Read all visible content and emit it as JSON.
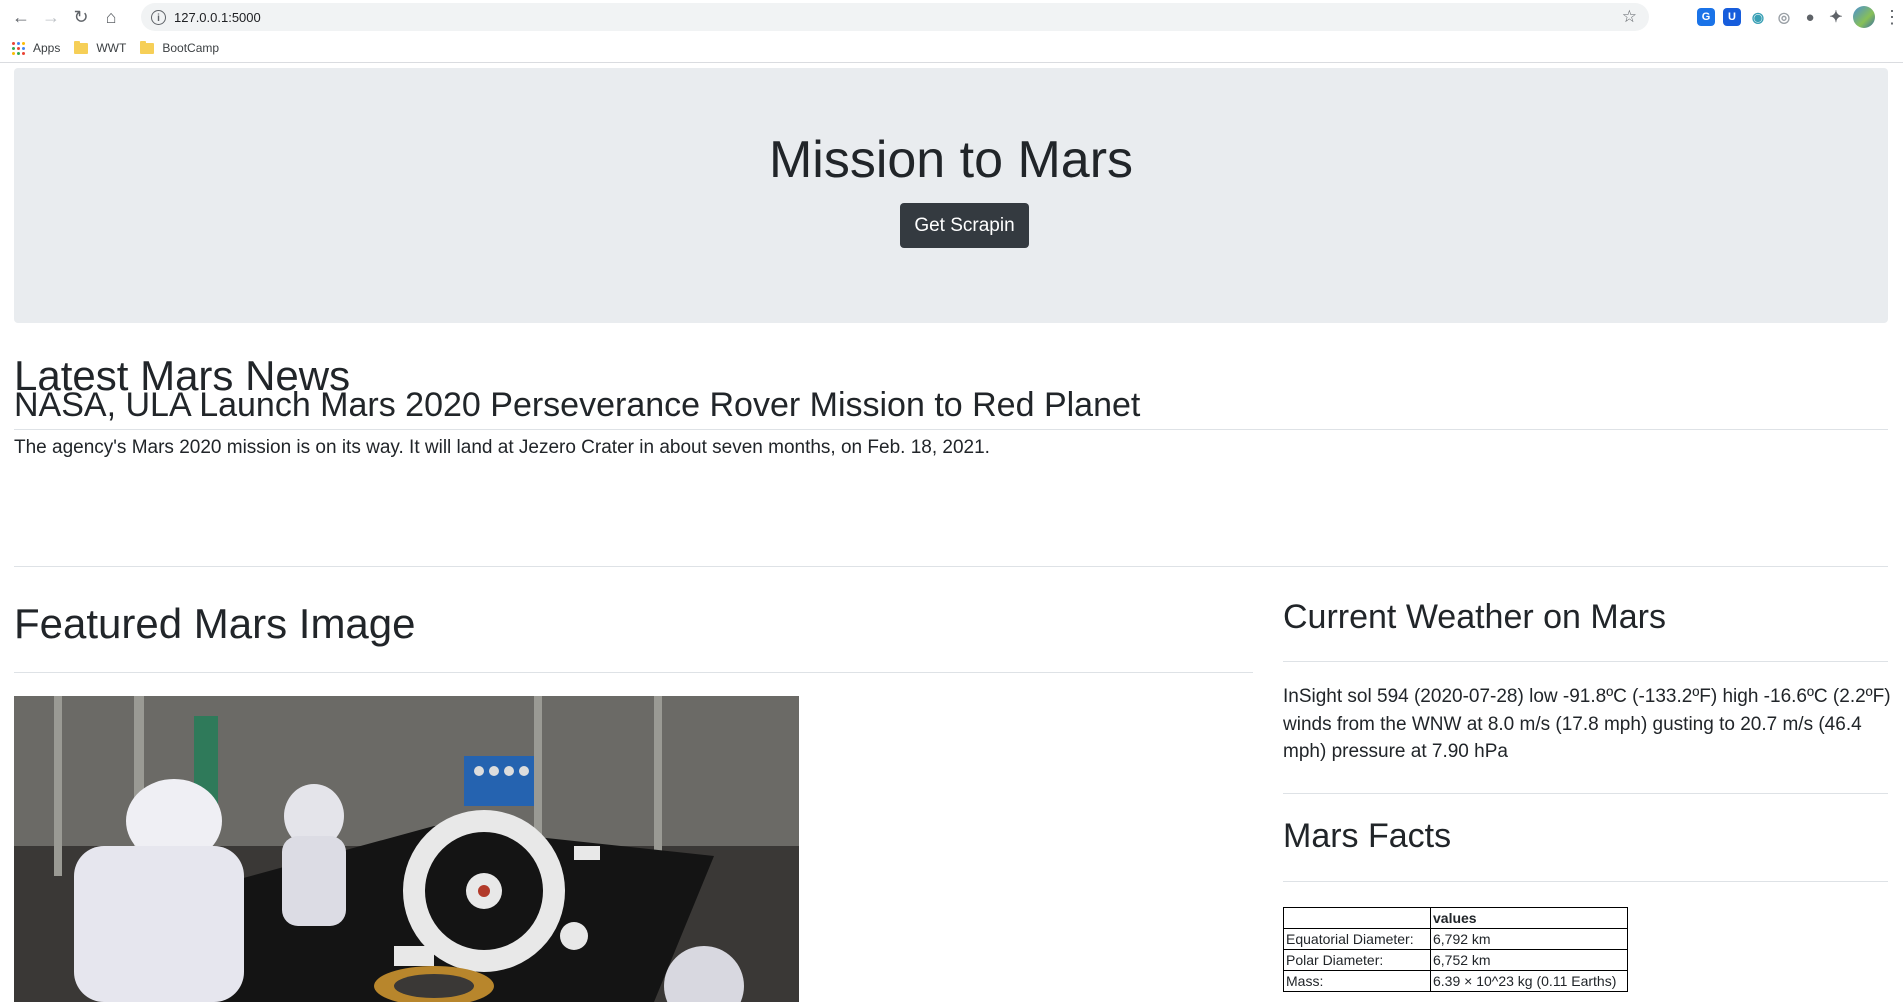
{
  "browser": {
    "url": "127.0.0.1:5000",
    "bookmarks": [
      {
        "label": "Apps"
      },
      {
        "label": "WWT"
      },
      {
        "label": "BootCamp"
      }
    ]
  },
  "jumbotron": {
    "title": "Mission to Mars",
    "button_label": "Get Scrapin"
  },
  "news": {
    "heading": "Latest Mars News",
    "title": "NASA, ULA Launch Mars 2020 Perseverance Rover Mission to Red Planet",
    "teaser": "The agency's Mars 2020 mission is on its way. It will land at Jezero Crater in about seven months, on Feb. 18, 2021."
  },
  "featured": {
    "heading": "Featured Mars Image"
  },
  "weather": {
    "heading": "Current Weather on Mars",
    "text": "InSight sol 594 (2020-07-28) low -91.8ºC (-133.2ºF) high -16.6ºC (2.2ºF) winds from the WNW at 8.0 m/s (17.8 mph) gusting to 20.7 m/s (46.4 mph) pressure at 7.90 hPa"
  },
  "facts": {
    "heading": "Mars Facts",
    "column_header": "values",
    "rows": [
      {
        "label": "Equatorial Diameter:",
        "value": "6,792 km"
      },
      {
        "label": "Polar Diameter:",
        "value": "6,752 km"
      },
      {
        "label": "Mass:",
        "value": "6.39 × 10^23 kg (0.11 Earths)"
      }
    ]
  }
}
